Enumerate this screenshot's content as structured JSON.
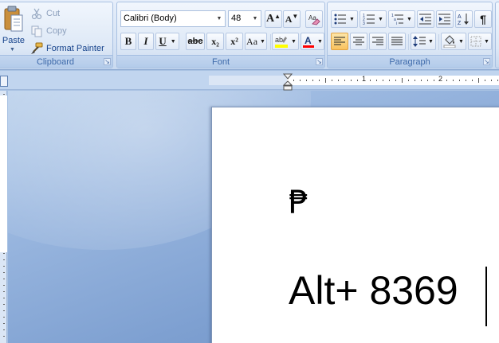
{
  "ribbon": {
    "clipboard": {
      "label": "Clipboard",
      "paste_label": "Paste",
      "cut_label": "Cut",
      "copy_label": "Copy",
      "format_painter_label": "Format Painter"
    },
    "font": {
      "label": "Font",
      "font_name": "Calibri (Body)",
      "font_size": "48",
      "bold": "B",
      "italic": "I",
      "underline": "U",
      "strikethrough": "abc",
      "subscript": "x₂",
      "superscript": "x²",
      "change_case": "Aa",
      "grow_font": "A",
      "shrink_font": "A",
      "highlight_color": "#ffff00",
      "font_color": "#ff0000"
    },
    "paragraph": {
      "label": "Paragraph",
      "show_marks": "¶",
      "active_alignment": "align-left"
    }
  },
  "ruler": {
    "labels": [
      "1",
      "1",
      "2"
    ]
  },
  "document": {
    "symbol": "₱",
    "text": "Alt+ 8369"
  }
}
